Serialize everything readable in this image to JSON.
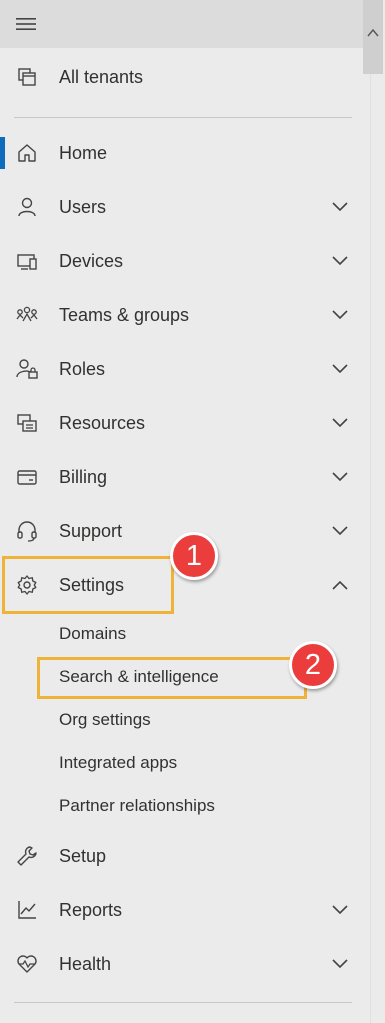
{
  "nav": {
    "all_tenants": "All tenants",
    "items": [
      {
        "label": "Home",
        "icon": "home-icon"
      },
      {
        "label": "Users",
        "icon": "user-icon"
      },
      {
        "label": "Devices",
        "icon": "devices-icon"
      },
      {
        "label": "Teams & groups",
        "icon": "teams-groups-icon"
      },
      {
        "label": "Roles",
        "icon": "roles-icon"
      },
      {
        "label": "Resources",
        "icon": "resources-icon"
      },
      {
        "label": "Billing",
        "icon": "billing-icon"
      },
      {
        "label": "Support",
        "icon": "headset-icon"
      },
      {
        "label": "Settings",
        "icon": "gear-icon"
      }
    ],
    "settings_children": [
      "Domains",
      "Search & intelligence",
      "Org settings",
      "Integrated apps",
      "Partner relationships"
    ],
    "bottom_items": [
      {
        "label": "Setup",
        "icon": "wrench-icon"
      },
      {
        "label": "Reports",
        "icon": "chart-icon"
      },
      {
        "label": "Health",
        "icon": "heart-pulse-icon"
      }
    ]
  },
  "annotations": {
    "badge1": "1",
    "badge2": "2"
  },
  "colors": {
    "active": "#0f6cbd",
    "highlight": "#f0b33a",
    "badge": "#ec3d3d"
  }
}
